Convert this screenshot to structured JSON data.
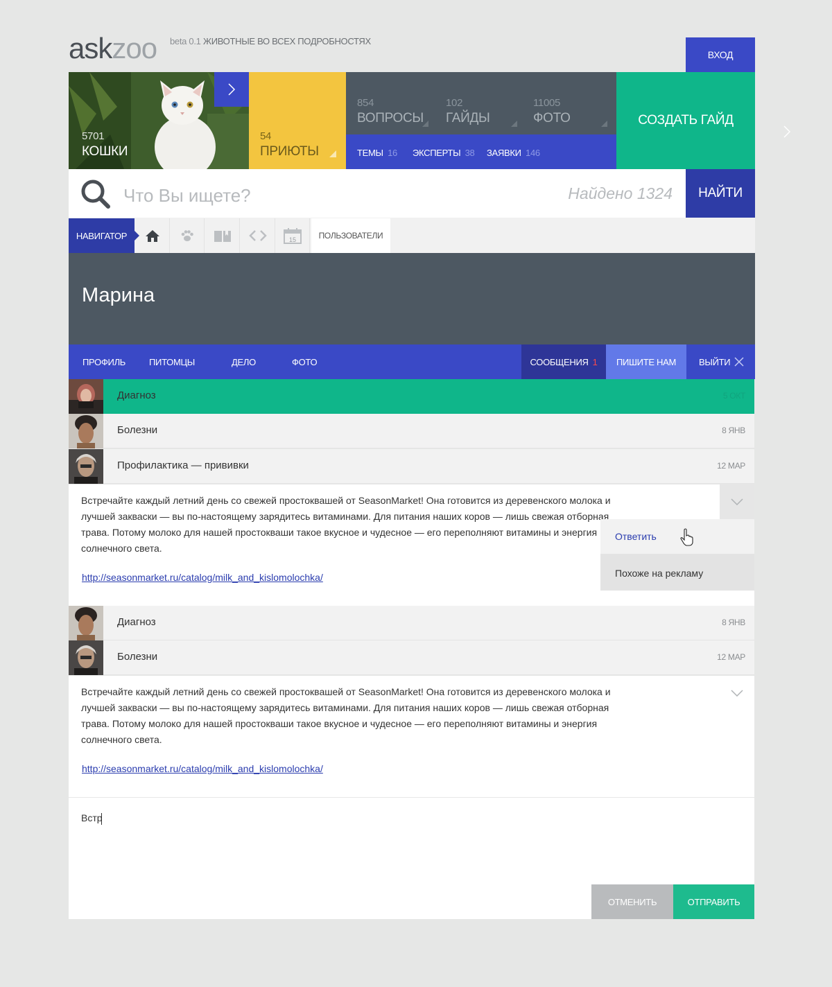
{
  "header": {
    "logo_ask": "ask",
    "logo_zoo": "zoo",
    "beta": "beta 0.1",
    "tagline": "ЖИВОТНЫЕ ВО ВСЕХ ПОДРОБНОСТЯХ",
    "login": "ВХОД"
  },
  "tiles": {
    "cats": {
      "count": "5701",
      "label": "КОШКИ"
    },
    "shelters": {
      "count": "54",
      "label": "ПРИЮТЫ"
    },
    "stats": [
      {
        "count": "854",
        "label": "ВОПРОСЫ"
      },
      {
        "count": "102",
        "label": "ГАЙДЫ"
      },
      {
        "count": "11005",
        "label": "ФОТО"
      }
    ],
    "sub": [
      {
        "label": "ТЕМЫ",
        "count": "16"
      },
      {
        "label": "ЭКСПЕРТЫ",
        "count": "38"
      },
      {
        "label": "ЗАЯВКИ",
        "count": "146"
      }
    ],
    "create": "СОЗДАТЬ ГАЙД"
  },
  "search": {
    "placeholder": "Что Вы ищете?",
    "found": "Найдено 1324",
    "button": "НАЙТИ"
  },
  "navigator": {
    "label": "НАВИГАТОР",
    "calendar_day": "15",
    "users": "ПОЛЬЗОВАТЕЛИ"
  },
  "profile": {
    "name": "Марина",
    "tabs": [
      "ПРОФИЛЬ",
      "ПИТОМЦЫ",
      "ДЕЛО",
      "ФОТО"
    ],
    "messages_label": "СООБЩЕНИЯ",
    "messages_count": "1",
    "write": "ПИШИТЕ НАМ",
    "logout": "ВЫЙТИ"
  },
  "messages": [
    {
      "subject": "Диагноз",
      "date": "5 ОКТ"
    },
    {
      "subject": "Болезни",
      "date": "8 ЯНВ"
    },
    {
      "subject": "Профилактика — прививки",
      "date": "12 МАР"
    },
    {
      "subject": "Диагноз",
      "date": "8 ЯНВ"
    },
    {
      "subject": "Болезни",
      "date": "12 МАР"
    }
  ],
  "message_body": {
    "text": "Встречайте каждый летний день со свежей простоквашей от SeasonMarket! Она готовится из деревенского молока и лучшей закваски — вы по-настоящему зарядитесь витаминами. Для питания наших коров — лишь свежая отборная трава. Потому молоко для нашей простокваши такое вкусное и чудесное — его переполняют витамины и энергия солнечного света.",
    "link": "http://seasonmarket.ru/catalog/milk_and_kislomolochka/"
  },
  "dropdown": {
    "reply": "Ответить",
    "spam": "Похоже на рекламу"
  },
  "reply": {
    "text": "Встр",
    "cancel": "ОТМЕНИТЬ",
    "send": "ОТПРАВИТЬ"
  }
}
